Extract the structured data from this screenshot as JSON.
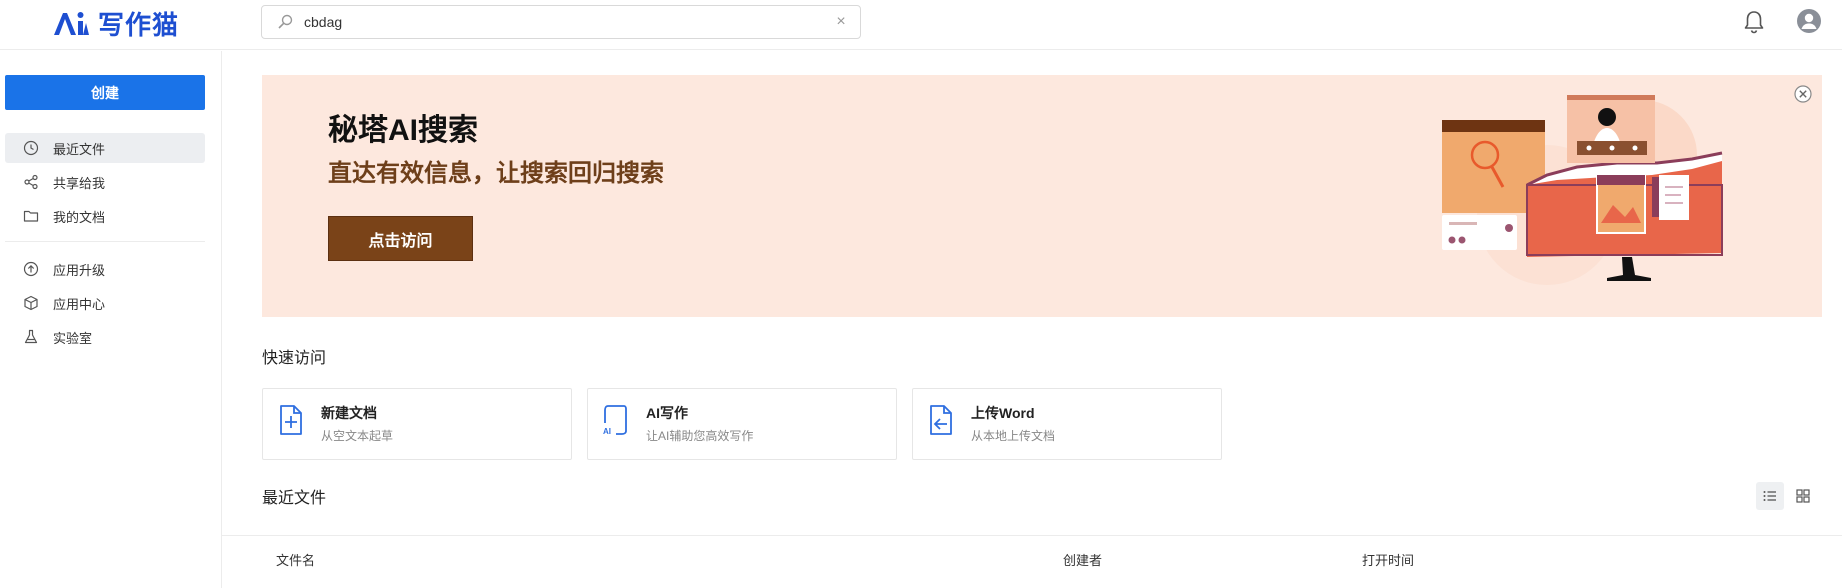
{
  "app": {
    "name": "写作猫",
    "brand_color": "#1e4fd1"
  },
  "search": {
    "value": "cbdag",
    "clear_label": "×"
  },
  "sidebar": {
    "create_label": "创建",
    "items": [
      {
        "label": "最近文件",
        "icon": "clock-icon",
        "active": true
      },
      {
        "label": "共享给我",
        "icon": "share-icon"
      },
      {
        "label": "我的文档",
        "icon": "folder-icon"
      },
      {
        "label": "应用升级",
        "icon": "upgrade-icon"
      },
      {
        "label": "应用中心",
        "icon": "cube-icon"
      },
      {
        "label": "实验室",
        "icon": "flask-icon"
      }
    ]
  },
  "banner": {
    "title": "秘塔AI搜索",
    "subtitle": "直达有效信息，让搜索回归搜索",
    "button_label": "点击访问",
    "background": "#fde8de",
    "button_color": "#7a4318"
  },
  "quick_access": {
    "title": "快速访问",
    "cards": [
      {
        "title": "新建文档",
        "desc": "从空文本起草",
        "icon": "new-doc-icon"
      },
      {
        "title": "AI写作",
        "desc": "让AI辅助您高效写作",
        "icon": "ai-write-icon",
        "icon_text": "AI"
      },
      {
        "title": "上传Word",
        "desc": "从本地上传文档",
        "icon": "upload-icon"
      }
    ]
  },
  "recent": {
    "title": "最近文件",
    "columns": [
      "文件名",
      "创建者",
      "打开时间"
    ]
  },
  "accent": "#1a73e8"
}
